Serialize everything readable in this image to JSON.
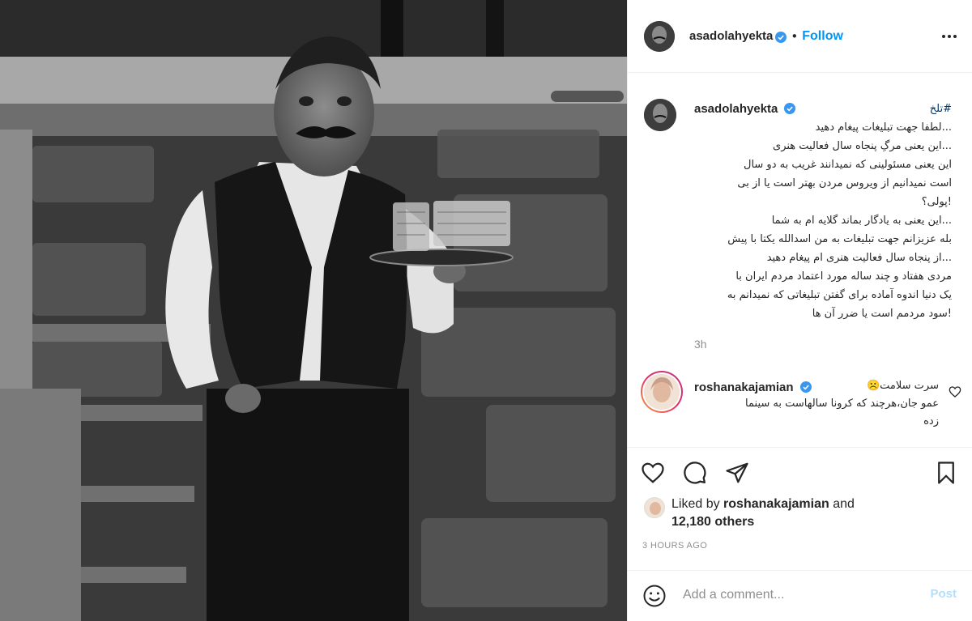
{
  "post": {
    "username": "asadolahyekta",
    "follow_label": "Follow",
    "separator": "•",
    "image_alt": "black and white photo of a man in a waiter's vest holding a tray with glasses on stage"
  },
  "caption": {
    "hashtag": "#تلخ",
    "lines": [
      "...لطفا جهت تبلیغات پیغام دهید",
      "...این یعنی مرگِ پنجاه سال فعالیت هنری",
      "این یعنی مسئولینی که نمیدانند غریب به دو سال",
      "است نمیدانیم از ویروس مردن بهتر است یا از بی",
      "!پولی؟",
      "...این یعنی به یادگار بماند گلایه ام به شما",
      "بله عزیزانم جهت تبلیغات به من اسدالله یکتا با پیش",
      "...از پنجاه سال فعالیت هنری ام پیغام دهید",
      "مردی هفتاد و چند ساله مورد اعتماد مردم ایران با",
      "یک دنیا اندوه آماده برای گفتن تبلیغاتی که نمیدانم به",
      "!سود مردمم است یا ضرر آن ها"
    ],
    "time": "3h"
  },
  "comment": {
    "username": "roshanakajamian",
    "line1": "سرت سلامت☹️",
    "line2": "عمو جان،هرچند که کرونا سالهاست به سینما",
    "line3": "زده"
  },
  "likes": {
    "prefix": "Liked by",
    "liker": "roshanakajamian",
    "joiner": "and",
    "others": "12,180 others"
  },
  "timestamp": "3 HOURS AGO",
  "add_comment": {
    "placeholder": "Add a comment...",
    "post_label": "Post"
  },
  "icons": {
    "verified": "verified-badge-icon",
    "more": "more-options-icon",
    "like": "heart-icon",
    "comment": "comment-icon",
    "share": "share-icon",
    "save": "bookmark-icon",
    "emoji": "emoji-icon"
  },
  "colors": {
    "accent": "#0095f6",
    "hashtag": "#00376b",
    "muted": "#8e8e8e",
    "post_disabled": "#b2dffc"
  }
}
